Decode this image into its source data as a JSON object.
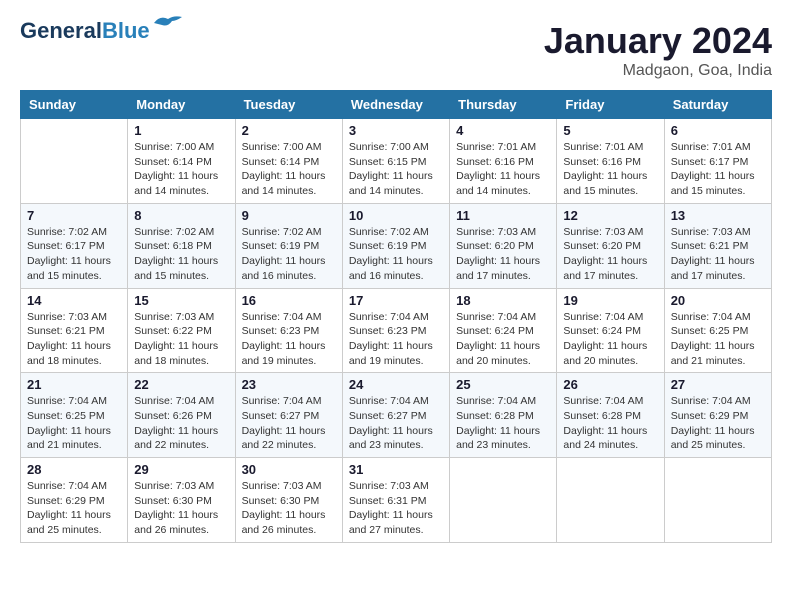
{
  "header": {
    "logo": {
      "line1": "General",
      "line2": "Blue"
    },
    "month": "January 2024",
    "location": "Madgaon, Goa, India"
  },
  "weekdays": [
    "Sunday",
    "Monday",
    "Tuesday",
    "Wednesday",
    "Thursday",
    "Friday",
    "Saturday"
  ],
  "weeks": [
    [
      {
        "day": "",
        "info": ""
      },
      {
        "day": "1",
        "info": "Sunrise: 7:00 AM\nSunset: 6:14 PM\nDaylight: 11 hours\nand 14 minutes."
      },
      {
        "day": "2",
        "info": "Sunrise: 7:00 AM\nSunset: 6:14 PM\nDaylight: 11 hours\nand 14 minutes."
      },
      {
        "day": "3",
        "info": "Sunrise: 7:00 AM\nSunset: 6:15 PM\nDaylight: 11 hours\nand 14 minutes."
      },
      {
        "day": "4",
        "info": "Sunrise: 7:01 AM\nSunset: 6:16 PM\nDaylight: 11 hours\nand 14 minutes."
      },
      {
        "day": "5",
        "info": "Sunrise: 7:01 AM\nSunset: 6:16 PM\nDaylight: 11 hours\nand 15 minutes."
      },
      {
        "day": "6",
        "info": "Sunrise: 7:01 AM\nSunset: 6:17 PM\nDaylight: 11 hours\nand 15 minutes."
      }
    ],
    [
      {
        "day": "7",
        "info": "Sunrise: 7:02 AM\nSunset: 6:17 PM\nDaylight: 11 hours\nand 15 minutes."
      },
      {
        "day": "8",
        "info": "Sunrise: 7:02 AM\nSunset: 6:18 PM\nDaylight: 11 hours\nand 15 minutes."
      },
      {
        "day": "9",
        "info": "Sunrise: 7:02 AM\nSunset: 6:19 PM\nDaylight: 11 hours\nand 16 minutes."
      },
      {
        "day": "10",
        "info": "Sunrise: 7:02 AM\nSunset: 6:19 PM\nDaylight: 11 hours\nand 16 minutes."
      },
      {
        "day": "11",
        "info": "Sunrise: 7:03 AM\nSunset: 6:20 PM\nDaylight: 11 hours\nand 17 minutes."
      },
      {
        "day": "12",
        "info": "Sunrise: 7:03 AM\nSunset: 6:20 PM\nDaylight: 11 hours\nand 17 minutes."
      },
      {
        "day": "13",
        "info": "Sunrise: 7:03 AM\nSunset: 6:21 PM\nDaylight: 11 hours\nand 17 minutes."
      }
    ],
    [
      {
        "day": "14",
        "info": "Sunrise: 7:03 AM\nSunset: 6:21 PM\nDaylight: 11 hours\nand 18 minutes."
      },
      {
        "day": "15",
        "info": "Sunrise: 7:03 AM\nSunset: 6:22 PM\nDaylight: 11 hours\nand 18 minutes."
      },
      {
        "day": "16",
        "info": "Sunrise: 7:04 AM\nSunset: 6:23 PM\nDaylight: 11 hours\nand 19 minutes."
      },
      {
        "day": "17",
        "info": "Sunrise: 7:04 AM\nSunset: 6:23 PM\nDaylight: 11 hours\nand 19 minutes."
      },
      {
        "day": "18",
        "info": "Sunrise: 7:04 AM\nSunset: 6:24 PM\nDaylight: 11 hours\nand 20 minutes."
      },
      {
        "day": "19",
        "info": "Sunrise: 7:04 AM\nSunset: 6:24 PM\nDaylight: 11 hours\nand 20 minutes."
      },
      {
        "day": "20",
        "info": "Sunrise: 7:04 AM\nSunset: 6:25 PM\nDaylight: 11 hours\nand 21 minutes."
      }
    ],
    [
      {
        "day": "21",
        "info": "Sunrise: 7:04 AM\nSunset: 6:25 PM\nDaylight: 11 hours\nand 21 minutes."
      },
      {
        "day": "22",
        "info": "Sunrise: 7:04 AM\nSunset: 6:26 PM\nDaylight: 11 hours\nand 22 minutes."
      },
      {
        "day": "23",
        "info": "Sunrise: 7:04 AM\nSunset: 6:27 PM\nDaylight: 11 hours\nand 22 minutes."
      },
      {
        "day": "24",
        "info": "Sunrise: 7:04 AM\nSunset: 6:27 PM\nDaylight: 11 hours\nand 23 minutes."
      },
      {
        "day": "25",
        "info": "Sunrise: 7:04 AM\nSunset: 6:28 PM\nDaylight: 11 hours\nand 23 minutes."
      },
      {
        "day": "26",
        "info": "Sunrise: 7:04 AM\nSunset: 6:28 PM\nDaylight: 11 hours\nand 24 minutes."
      },
      {
        "day": "27",
        "info": "Sunrise: 7:04 AM\nSunset: 6:29 PM\nDaylight: 11 hours\nand 25 minutes."
      }
    ],
    [
      {
        "day": "28",
        "info": "Sunrise: 7:04 AM\nSunset: 6:29 PM\nDaylight: 11 hours\nand 25 minutes."
      },
      {
        "day": "29",
        "info": "Sunrise: 7:03 AM\nSunset: 6:30 PM\nDaylight: 11 hours\nand 26 minutes."
      },
      {
        "day": "30",
        "info": "Sunrise: 7:03 AM\nSunset: 6:30 PM\nDaylight: 11 hours\nand 26 minutes."
      },
      {
        "day": "31",
        "info": "Sunrise: 7:03 AM\nSunset: 6:31 PM\nDaylight: 11 hours\nand 27 minutes."
      },
      {
        "day": "",
        "info": ""
      },
      {
        "day": "",
        "info": ""
      },
      {
        "day": "",
        "info": ""
      }
    ]
  ]
}
